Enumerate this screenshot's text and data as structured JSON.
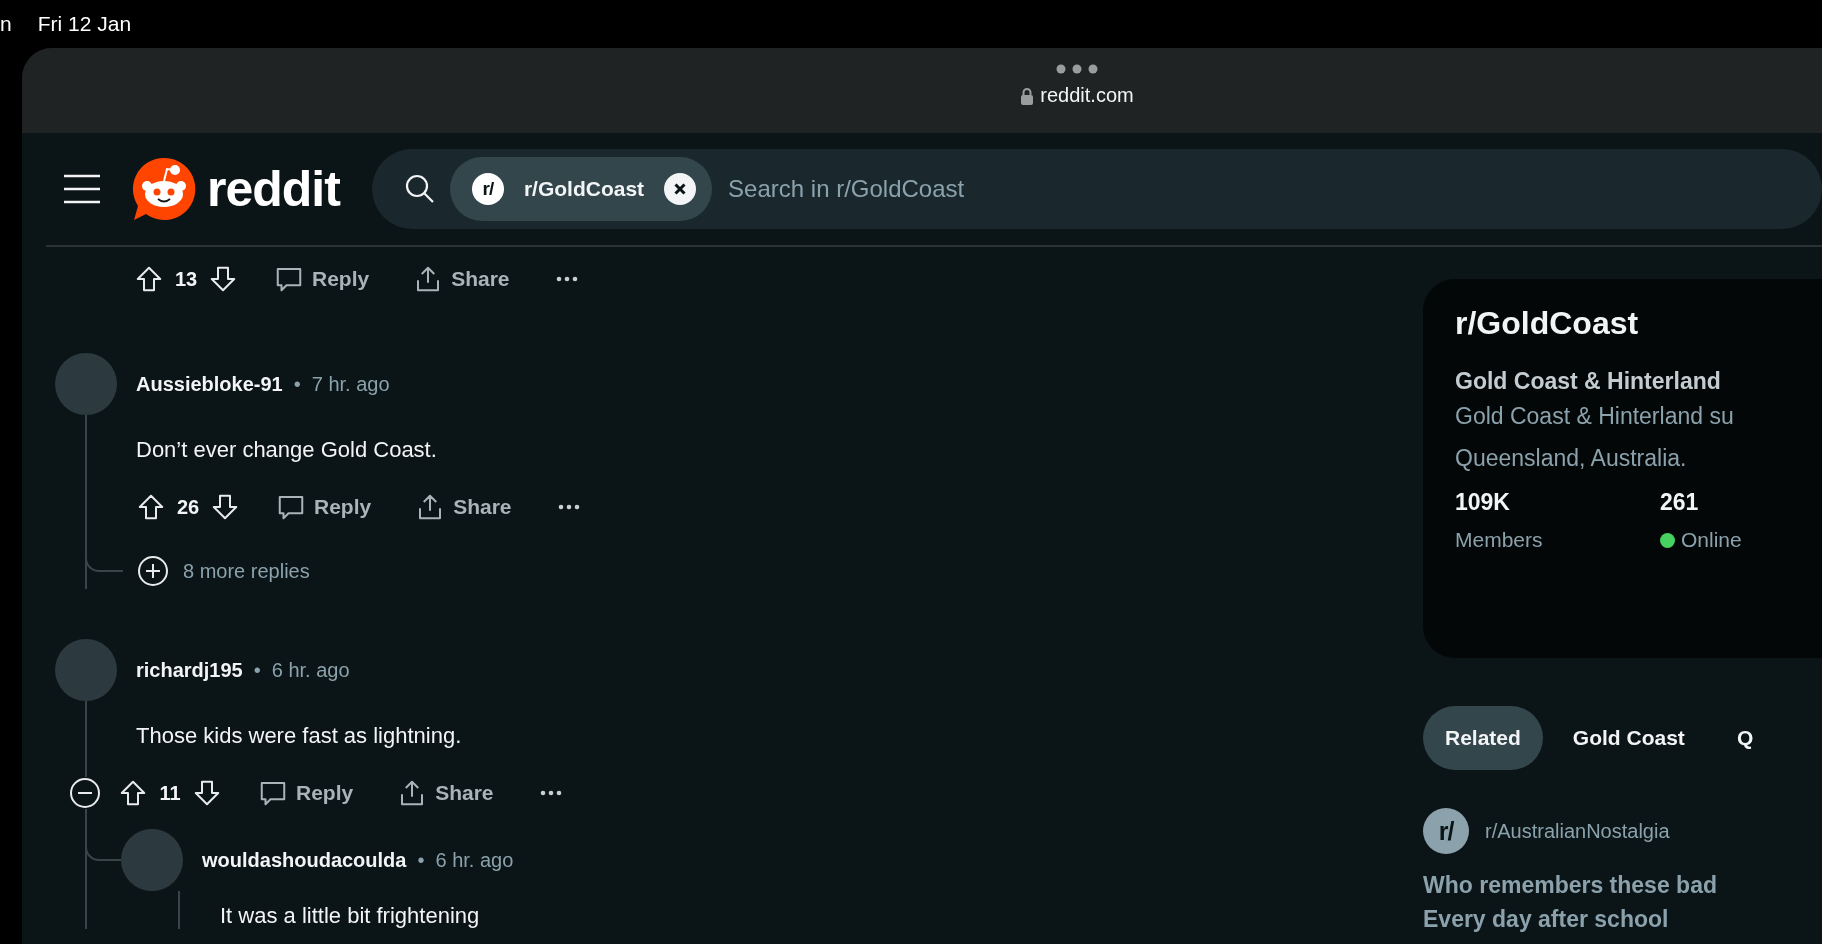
{
  "status_bar": {
    "fragment": "n",
    "date": "Fri 12 Jan"
  },
  "browser": {
    "url": "reddit.com"
  },
  "header": {
    "logo_text": "reddit",
    "search": {
      "chip_icon": "r/",
      "chip_label": "r/GoldCoast",
      "placeholder": "Search in r/GoldCoast"
    }
  },
  "top_actions": {
    "votes": "13",
    "reply": "Reply",
    "share": "Share"
  },
  "comments": [
    {
      "username": "Aussiebloke-91",
      "separator": "•",
      "time": "7 hr. ago",
      "body": "Don’t ever change Gold Coast.",
      "votes": "26",
      "reply": "Reply",
      "share": "Share",
      "collapse_control": false,
      "more_replies": "8 more replies"
    },
    {
      "username": "richardj195",
      "separator": "•",
      "time": "6 hr. ago",
      "body": "Those kids were fast as lightning.",
      "votes": "11",
      "reply": "Reply",
      "share": "Share",
      "collapse_control": true,
      "replies": [
        {
          "username": "wouldashoudacoulda",
          "separator": "•",
          "time": "6 hr. ago",
          "body": "It was a little bit frightening"
        }
      ]
    }
  ],
  "sidebar": {
    "title": "r/GoldCoast",
    "subtitle": "Gold Coast & Hinterland",
    "description_lines": [
      "Gold Coast & Hinterland su",
      "Queensland, Australia."
    ],
    "stats": [
      {
        "value": "109K",
        "label": "Members"
      },
      {
        "value": "261",
        "label": "Online",
        "color": "#46d160"
      }
    ],
    "tabs": [
      {
        "label": "Related",
        "selected": true
      },
      {
        "label": "Gold Coast",
        "selected": false
      },
      {
        "label": "Q",
        "selected": false
      }
    ],
    "related_post": {
      "community_icon": "r/",
      "community": "r/AustralianNostalgia",
      "title_lines": [
        "Who remembers these bad",
        "Every day after school"
      ]
    }
  }
}
